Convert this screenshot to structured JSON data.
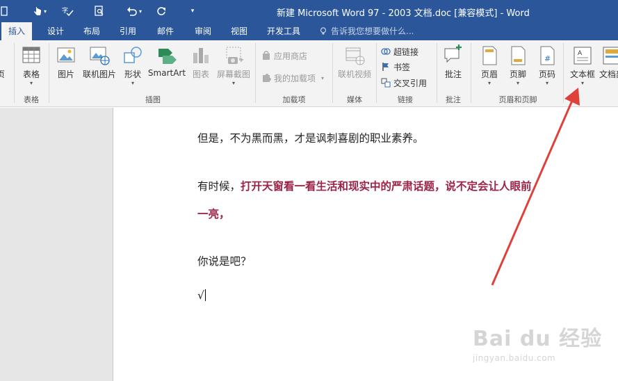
{
  "window": {
    "title": "新建 Microsoft Word 97 - 2003 文档.doc [兼容模式] - Word"
  },
  "tabs": [
    {
      "label": "插入",
      "active": true
    },
    {
      "label": "设计"
    },
    {
      "label": "布局"
    },
    {
      "label": "引用"
    },
    {
      "label": "邮件"
    },
    {
      "label": "审阅"
    },
    {
      "label": "视图"
    },
    {
      "label": "开发工具"
    }
  ],
  "tell_me": "告诉我您想要做什么...",
  "ribbon": {
    "groups": {
      "tables": "表格",
      "illustrations": "插图",
      "addins": "加载项",
      "media": "媒体",
      "links": "链接",
      "comments": "批注",
      "header_footer": "页眉和页脚"
    },
    "buttons": {
      "page_cut": "页",
      "table": "表格",
      "picture": "图片",
      "online_picture": "联机图片",
      "shapes": "形状",
      "smartart": "SmartArt",
      "chart": "图表",
      "screenshot": "屏幕截图",
      "store": "应用商店",
      "my_addins": "我的加载项",
      "online_video": "联机视频",
      "hyperlink": "超链接",
      "bookmark": "书签",
      "cross_ref": "交叉引用",
      "comment": "批注",
      "header": "页眉",
      "footer": "页脚",
      "page_number": "页码",
      "textbox": "文本框",
      "textbox_next": "文档部"
    }
  },
  "document": {
    "p1": "但是，不为黑而黑，才是讽刺喜剧的职业素养。",
    "p2_prefix": "有时候，",
    "p2_bold_line1": "打开天窗看一看生活和现实中的严肃话题，说不定会让人眼前",
    "p2_bold_line2": "一亮，",
    "p3": "你说是吧？",
    "p4": "√"
  },
  "watermark": {
    "main": "Bai du 经验",
    "url": "jingyan.baidu.com"
  },
  "colors": {
    "title_bar": "#2b579a",
    "ribbon_bg": "#f3f3f3",
    "highlight_text": "#9b2347",
    "annotation_arrow": "#e0403a"
  }
}
